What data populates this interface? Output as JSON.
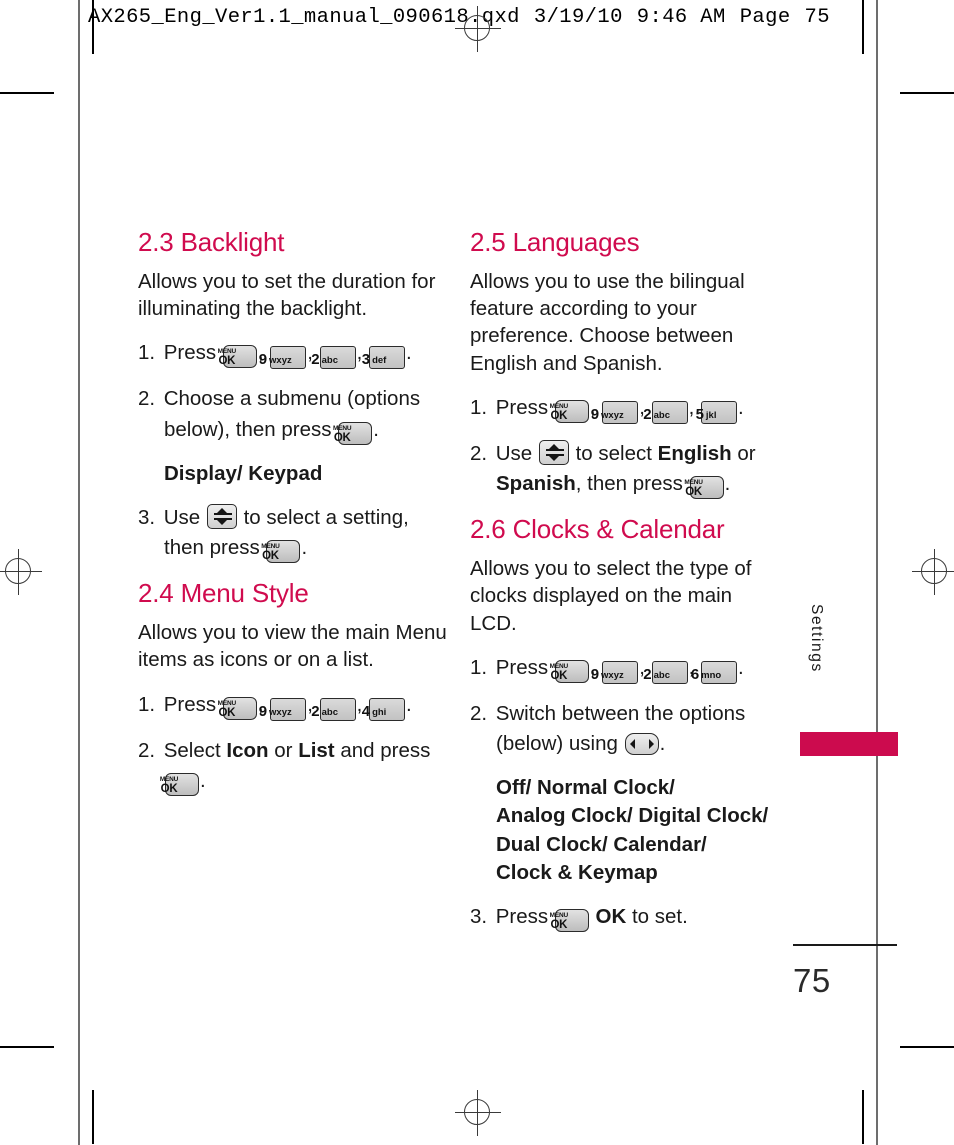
{
  "prepress": {
    "filename": "AX265_Eng_Ver1.1_manual_090618.qxd",
    "date": "3/19/10",
    "time": "9:46 AM",
    "page_label": "Page",
    "page_number_header": "75"
  },
  "side_tab": {
    "label": "Settings",
    "swatch_color": "#cc0b4e"
  },
  "folio": {
    "page_number": "75"
  },
  "theme": {
    "heading_color": "#d00b4e",
    "text_color": "#1a1a1a",
    "key_fill": "#c9c9c9"
  },
  "keys": {
    "menu_ok": {
      "top": "MENU",
      "bottom": "OK"
    },
    "num9": {
      "digit": "9",
      "letters": "wxyz"
    },
    "num2": {
      "digit": "2",
      "letters": "abc"
    },
    "num3": {
      "digit": "3",
      "letters": "def"
    },
    "num4": {
      "digit": "4",
      "letters": "ghi"
    },
    "num5": {
      "digit": "5",
      "letters": "jkl"
    },
    "num6": {
      "digit": "6",
      "letters": "mno"
    },
    "updown": "up-down-navigation-key",
    "leftright": "left-right-navigation-key"
  },
  "left_column": {
    "backlight": {
      "title": "2.3 Backlight",
      "intro": "Allows you to set the duration for illuminating the backlight.",
      "step1_num": "1.",
      "step1_verb": "Press",
      "step1_comma": ",",
      "step1_period": ".",
      "step2_num": "2.",
      "step2_text_a": "Choose a submenu (options below), then press",
      "step2_period": ".",
      "submenu_options": "Display/ Keypad",
      "step3_num": "3.",
      "step3_verb": "Use",
      "step3_text_a": "to select a setting, then press",
      "step3_period": "."
    },
    "menu_style": {
      "title": "2.4 Menu Style",
      "intro": "Allows you to view the main Menu items as icons or on a list.",
      "step1_num": "1.",
      "step1_verb": "Press",
      "step1_comma": ",",
      "step1_period": ".",
      "step2_num": "2.",
      "step2_a": "Select",
      "step2_bold1": "Icon",
      "step2_b": "or",
      "step2_bold2": "List",
      "step2_c": "and press",
      "step2_period": "."
    }
  },
  "right_column": {
    "languages": {
      "title": "2.5 Languages",
      "intro": "Allows you to use the bilingual feature according to your preference. Choose between English and Spanish.",
      "step1_num": "1.",
      "step1_verb": "Press",
      "step1_comma": ",",
      "step1_period": ".",
      "step2_num": "2.",
      "step2_verb": "Use",
      "step2_a": "to select",
      "step2_bold1": "English",
      "step2_b": "or",
      "step2_bold2": "Spanish",
      "step2_c": ", then press",
      "step2_period": "."
    },
    "clocks_calendar": {
      "title": "2.6 Clocks & Calendar",
      "intro": "Allows you to select the type of clocks displayed on the main LCD.",
      "step1_num": "1.",
      "step1_verb": "Press",
      "step1_comma": ",",
      "step1_period": ".",
      "step2_num": "2.",
      "step2_a": "Switch between the options (below) using",
      "step2_period": ".",
      "options": [
        "Off/ Normal Clock/",
        "Analog Clock/ Digital Clock/",
        "Dual Clock/ Calendar/",
        "Clock & Keymap"
      ],
      "step3_num": "3.",
      "step3_verb": "Press",
      "step3_bold": "OK",
      "step3_tail": "to set."
    }
  }
}
